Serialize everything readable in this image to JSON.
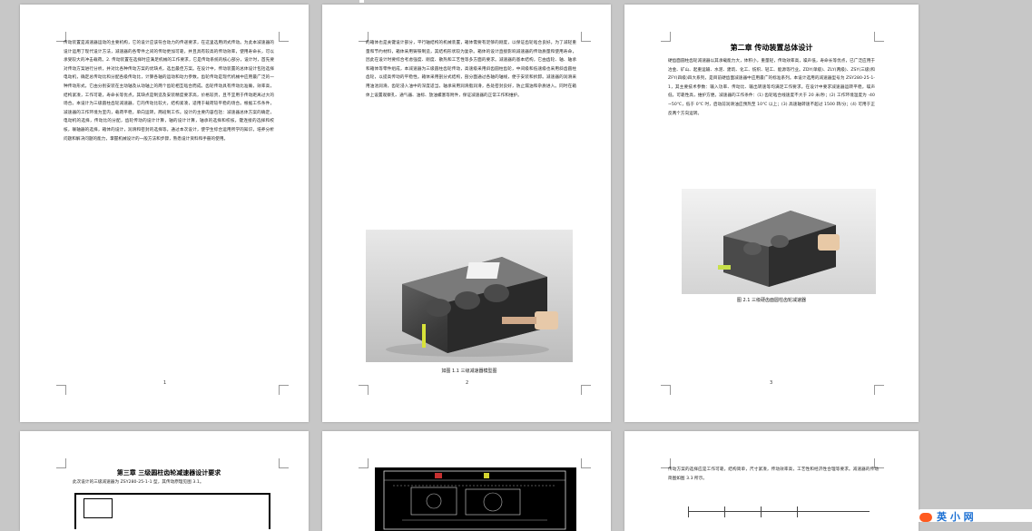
{
  "pages": {
    "p1": {
      "body": "传动装置是减速器运动的主要机构，它的设计应该符合动力的传递要求，在这里选用闭式传动。为此本减速器的设计运用了现代设计方法，减速器的各零件之间的传动更加可靠，并且具有较高的传动效率，使用寿命长，可以承受较大的冲击载荷。2. 传动装置在选择时应满足机械的工作要求，它是传动系统的核心部分，设计时，首先要对传动方案进行分析，并对比各种传动方案的优缺点，选出最佳方案。在设计中，传动装置的总体设计包括选择电动机，确定总传动比和分配各级传动比，计算各轴的运动和动力参数。齿轮传动是现代机械中应用最广泛的一种传动形式，它由分别安装在主动轴及从动轴上的两个齿轮相互啮合而成。齿轮传动具有传动比准确，效率高，结构紧凑，工作可靠，寿命长等优点。其缺点是制造及安装精度要求高，价格较贵，且不宜用于传动距离过大的场合。本设计为三级圆柱齿轮减速器，它的传动比较大，结构紧凑，适用于载荷较平稳的场合。根据工作条件，减速器的工作环境为室内，载荷平稳，单向运转，两班制工作。设计的主要内容包括：减速器总体方案的确定，电动机的选择，传动比的分配，齿轮传动的设计计算，轴的设计计算，轴承的选择和校核，键连接的选择和校核，联轴器的选择，箱体的设计，润滑和密封的选择等。通过本次设计，使学生综合运用所学的知识，培养分析问题和解决问题的能力，掌握机械设计的一般方法和步骤，熟悉设计资料和手册的使用。",
      "page_num": "1"
    },
    "p2": {
      "body": "的箱体也是关键设计部分，平行轴结构的机械装置，箱体需要有足够的刚度，以保证齿轮啮合良好。为了减轻重量和节约材料，箱体采用铸铁制造，其结构形状较为复杂。箱体的设计直接影响减速器的传动质量和使用寿命，因此在设计时要综合考虑强度、刚度、散热和工艺性等多方面的要求。减速器的基本结构，它由齿轮、轴、轴承和箱体等零件组成，本减速器为三级圆柱齿轮传动，高速级采用斜齿圆柱齿轮，中间级和低速级也采用斜齿圆柱齿轮，以提高传动的平稳性。箱体采用剖分式结构，剖分面通过各轴的轴线，便于安装和拆卸。减速器的润滑采用油池润滑，齿轮浸入油中的深度适当，轴承采用润滑脂润滑，各处密封良好，防止漏油和杂质进入。同时在箱体上设置观察孔、通气器、油标、放油螺塞等附件，保证减速器的正常工作和维护。",
      "caption": "如图 1.1 三级减速器模型图",
      "page_num": "2"
    },
    "p3": {
      "heading": "第二章  传动装置总体设计",
      "body": "硬齿面圆柱齿轮减速器以其承载能力大，体积小，重量轻，传动效率高，噪声低，寿命长等优点，已广泛应用于冶金、矿山、起重运输、水泥、建筑、化工、纺织、轻工、能源等行业。ZDY(单级)、ZLY(两级)、ZSY(三级)和 ZFY(四级)四大系列，是目前硬齿面减速器中应用最广的标准系列。本设计选用的减速器型号为 ZSY280-25-1-1，其主要技术参数：输入功率、传动比、输出转速等均满足工作要求。在设计中要求减速器运转平稳，噪声低，可靠性高，维护方便。减速器的工作条件：(1) 齿轮啮合线速度不大于 20 米/秒；(2) 工作环境温度为 -40~50℃，低于 0℃ 时，启动前润滑油应预热至 10℃ 以上；(3) 高速轴转速不超过 1500 转/分；(4) 可用于正反两个方向运转。",
      "caption": "图 2.1 三级硬齿面圆柱齿轮减速器",
      "page_num": "3"
    },
    "p4": {
      "heading": "第三章  三级圆柱齿轮减速器设计要求",
      "body": "此次设计的三级减速器为 ZSY280-25-1-1 型，其传动原理见图 3.1。"
    },
    "p6": {
      "body": "传动方案的选择应是工作可靠，结构简单，尺寸紧凑，传动效率高，工艺性和经济性合理等要求。减速器的传动简图如图 3.3 所示。"
    }
  },
  "logo": {
    "label": "英 小 网"
  }
}
